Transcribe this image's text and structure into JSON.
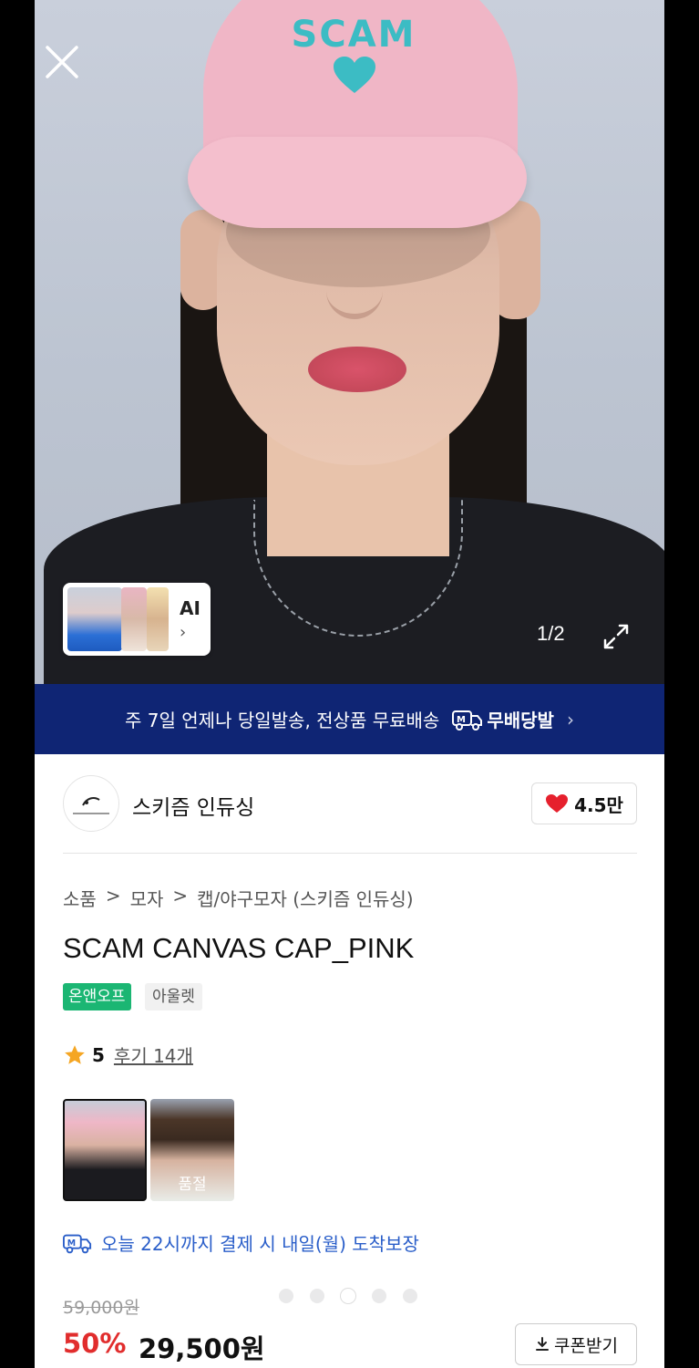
{
  "hero": {
    "counter": "1/2",
    "ai_label": "AI",
    "ai_chevron": "›",
    "cap_text": "SCAM",
    "icons": [
      "close-icon",
      "expand-icon",
      "heart-icon"
    ]
  },
  "banner": {
    "message": "주 7일 언제나 당일발송, 전상품 무료배송",
    "brand": "무배당발",
    "chevron": "›"
  },
  "store": {
    "name": "스키즘 인듀싱",
    "likes": "4.5만"
  },
  "breadcrumb": [
    "소품",
    ">",
    "모자",
    ">",
    "캡/야구모자 (스키즘 인듀싱)"
  ],
  "product": {
    "title": "SCAM CANVAS CAP_PINK",
    "tag_primary": "온앤오프",
    "tag_secondary": "아울렛",
    "rating": "5",
    "reviews": "후기 14개",
    "swatch_sold_label": "품절"
  },
  "delivery": {
    "text": "오늘 22시까지 결제 시 내일(월) 도착보장"
  },
  "price": {
    "original": "59,000원",
    "discount": "50%",
    "sale": "29,500원",
    "coupon_label": "쿠폰받기"
  },
  "pager": {
    "total": 5,
    "active": 3
  },
  "colors": {
    "banner": "#0f2574",
    "discount": "#e12d2d",
    "tag_green": "#1bb673",
    "link_blue": "#2a5ec9",
    "heart": "#e6202d"
  }
}
